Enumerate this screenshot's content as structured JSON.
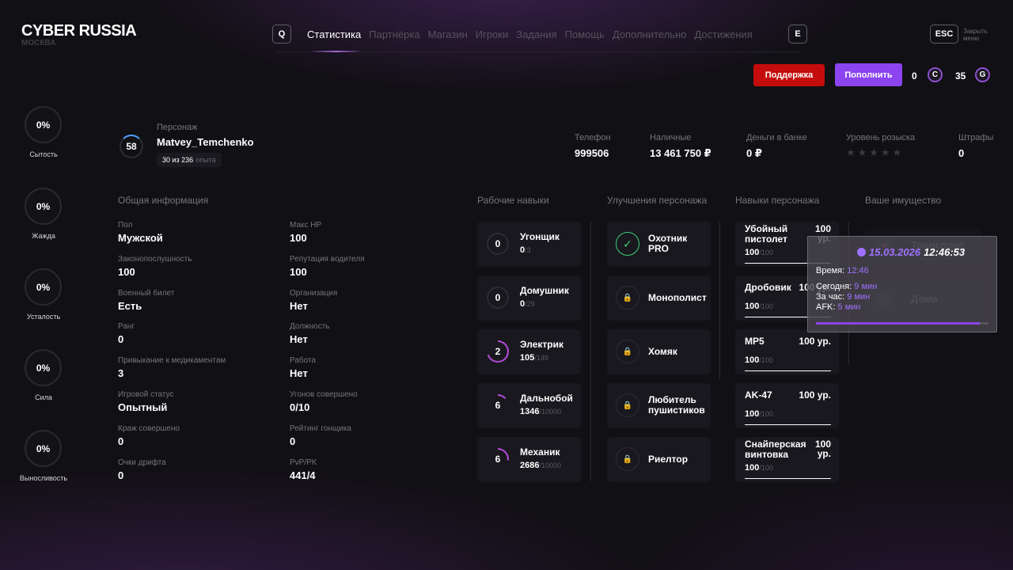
{
  "brand": {
    "title": "CYBER RUSSIA",
    "city": "МОСКВА"
  },
  "nav": {
    "left_key": "Q",
    "right_key": "E",
    "tabs": [
      "Статистика",
      "Партнёрка",
      "Магазин",
      "Игроки",
      "Задания",
      "Помощь",
      "Дополнительно",
      "Достижения"
    ],
    "active_tab": "Статистика"
  },
  "esc": {
    "key": "ESC",
    "label_1": "Закрыть",
    "label_2": "меню"
  },
  "actions": {
    "support": "Поддержка",
    "topup": "Пополнить"
  },
  "currency": {
    "c_value": "0",
    "c_symbol": "C",
    "g_value": "35",
    "g_symbol": "G"
  },
  "needs": [
    {
      "value": "0%",
      "label": "Сытость"
    },
    {
      "value": "0%",
      "label": "Жажда"
    },
    {
      "value": "0%",
      "label": "Усталость"
    },
    {
      "value": "0%",
      "label": "Сила"
    },
    {
      "value": "0%",
      "label": "Выносливость"
    }
  ],
  "character": {
    "level": "58",
    "label": "Персонаж",
    "name": "Matvey_Temchenko",
    "xp_value": "30 из 236",
    "xp_suffix": "опыта"
  },
  "summary": [
    {
      "label": "Телефон",
      "value": "999506"
    },
    {
      "label": "Наличные",
      "value": "13 461 750 ₽"
    },
    {
      "label": "Деньги в банке",
      "value": "0 ₽"
    },
    {
      "label": "Уровень розыска",
      "value": ""
    },
    {
      "label": "Штрафы",
      "value": "0"
    }
  ],
  "wanted": {
    "stars": 5,
    "active": 0
  },
  "sections": {
    "general": "Общая информация",
    "work": "Рабочие навыки",
    "upgrades": "Улучшения персонажа",
    "skills": "Навыки персонажа",
    "property": "Ваше имущество"
  },
  "general_left": [
    {
      "label": "Пол",
      "value": "Мужской"
    },
    {
      "label": "Законопослушность",
      "value": "100"
    },
    {
      "label": "Военный билет",
      "value": "Есть"
    },
    {
      "label": "Ранг",
      "value": "0"
    },
    {
      "label": "Привыкание к медикаментам",
      "value": "3"
    },
    {
      "label": "Игровой статус",
      "value": "Опытный"
    },
    {
      "label": "Краж совершено",
      "value": "0"
    },
    {
      "label": "Очки дрифта",
      "value": "0"
    }
  ],
  "general_right": [
    {
      "label": "Макс HP",
      "value": "100"
    },
    {
      "label": "Репутация водителя",
      "value": "100"
    },
    {
      "label": "Организация",
      "value": "Нет"
    },
    {
      "label": "Должность",
      "value": "Нет"
    },
    {
      "label": "Работа",
      "value": "Нет"
    },
    {
      "label": "Угонов совершено",
      "value": "0/10"
    },
    {
      "label": "Рейтинг гонщика",
      "value": "0"
    },
    {
      "label": "PvP/PK",
      "value": "441/4"
    }
  ],
  "work_skills": [
    {
      "level": "0",
      "name": "Угонщик",
      "value": "0",
      "max": "/3",
      "progress": 0
    },
    {
      "level": "0",
      "name": "Домушник",
      "value": "0",
      "max": "/29",
      "progress": 0
    },
    {
      "level": "2",
      "name": "Электрик",
      "value": "105",
      "max": "/149",
      "progress": 0.7
    },
    {
      "level": "6",
      "name": "Дальнобой",
      "value": "1346",
      "max": "/10000",
      "progress": 0.13
    },
    {
      "level": "6",
      "name": "Механик",
      "value": "2686",
      "max": "/10000",
      "progress": 0.27
    }
  ],
  "upgrades": [
    {
      "line1": "Охотник",
      "line2": "PRO",
      "unlocked": true
    },
    {
      "line1": "Монополист",
      "line2": "",
      "unlocked": false
    },
    {
      "line1": "Хомяк",
      "line2": "",
      "unlocked": false
    },
    {
      "line1": "Любитель",
      "line2": "пушистиков",
      "unlocked": false
    },
    {
      "line1": "Риелтор",
      "line2": "",
      "unlocked": false
    }
  ],
  "char_skills": [
    {
      "n1": "Убойный",
      "n2": "пистолет",
      "l1": "100",
      "l2": "ур.",
      "value": "100",
      "max": "/100"
    },
    {
      "n1": "Дробовик",
      "n2": "",
      "l1": "100 ур.",
      "l2": "",
      "value": "100",
      "max": "/100"
    },
    {
      "n1": "MP5",
      "n2": "",
      "l1": "100 ур.",
      "l2": "",
      "value": "100",
      "max": "/100"
    },
    {
      "n1": "AK-47",
      "n2": "",
      "l1": "100 ур.",
      "l2": "",
      "value": "100",
      "max": "/100"
    },
    {
      "n1": "Снайперская",
      "n2": "винтовка",
      "l1": "100",
      "l2": "ур.",
      "value": "100",
      "max": "/100"
    }
  ],
  "property": [
    {
      "name": "Транспорт",
      "icon": "car-icon"
    },
    {
      "name": "Дома",
      "icon": "house-icon"
    }
  ],
  "tooltip": {
    "date": "15.03.2026",
    "time": "12:46:53",
    "time_label": "Время:",
    "time_value": "12:46",
    "today_label": "Сегодня:",
    "today_value": "9 мин",
    "hour_label": "За час:",
    "hour_value": "9 мин",
    "afk_label": "AFK:",
    "afk_value": "5 мин",
    "progress": 0.95
  },
  "colors": {
    "accent": "#8b44f0",
    "support": "#c50c0c",
    "ok": "#3bd07a",
    "link": "#a072ff"
  }
}
